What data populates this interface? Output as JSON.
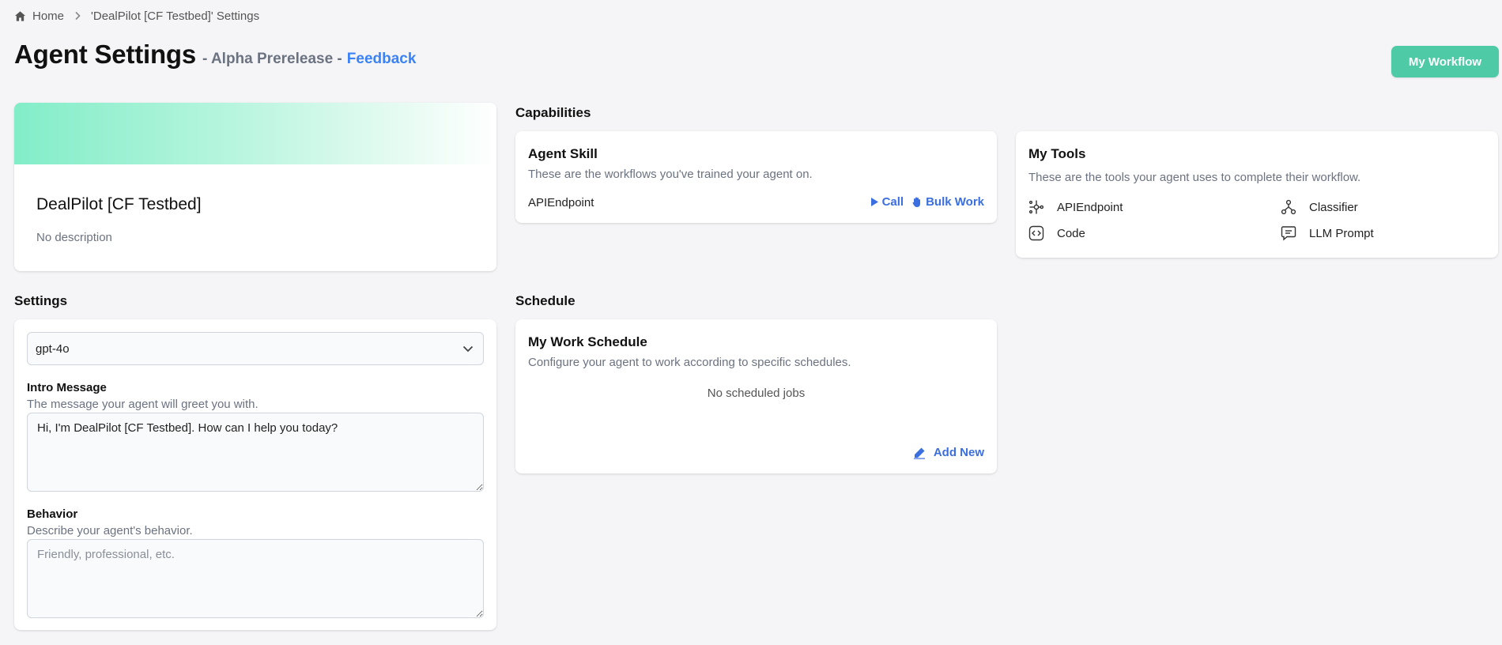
{
  "breadcrumb": {
    "home": "Home",
    "current": "'DealPilot [CF Testbed]' Settings"
  },
  "header": {
    "title": "Agent Settings",
    "subtitle": "- Alpha Prerelease -",
    "feedback": "Feedback",
    "workflow_button": "My Workflow"
  },
  "profile": {
    "name": "DealPilot [CF Testbed]",
    "description": "No description"
  },
  "capabilities": {
    "heading": "Capabilities",
    "skill": {
      "title": "Agent Skill",
      "subtitle": "These are the workflows you've trained your agent on.",
      "endpoint": "APIEndpoint",
      "call_label": "Call",
      "bulk_label": "Bulk Work"
    },
    "tools": {
      "title": "My Tools",
      "subtitle": "These are the tools your agent uses to complete their workflow.",
      "items": [
        {
          "label": "APIEndpoint",
          "icon": "api-endpoint-icon"
        },
        {
          "label": "Classifier",
          "icon": "classifier-icon"
        },
        {
          "label": "Code",
          "icon": "code-icon"
        },
        {
          "label": "LLM Prompt",
          "icon": "llm-prompt-icon"
        }
      ]
    }
  },
  "settings": {
    "heading": "Settings",
    "model": "gpt-4o",
    "intro_label": "Intro Message",
    "intro_help": "The message your agent will greet you with.",
    "intro_value": "Hi, I'm DealPilot [CF Testbed]. How can I help you today?",
    "behavior_label": "Behavior",
    "behavior_help": "Describe your agent's behavior.",
    "behavior_value": "",
    "behavior_placeholder": "Friendly, professional, etc."
  },
  "schedule": {
    "heading": "Schedule",
    "title": "My Work Schedule",
    "subtitle": "Configure your agent to work according to specific schedules.",
    "empty": "No scheduled jobs",
    "add_label": "Add New"
  },
  "colors": {
    "accent": "#4ecba6",
    "link": "#3b6fe0",
    "banner_start": "#82edc8"
  }
}
